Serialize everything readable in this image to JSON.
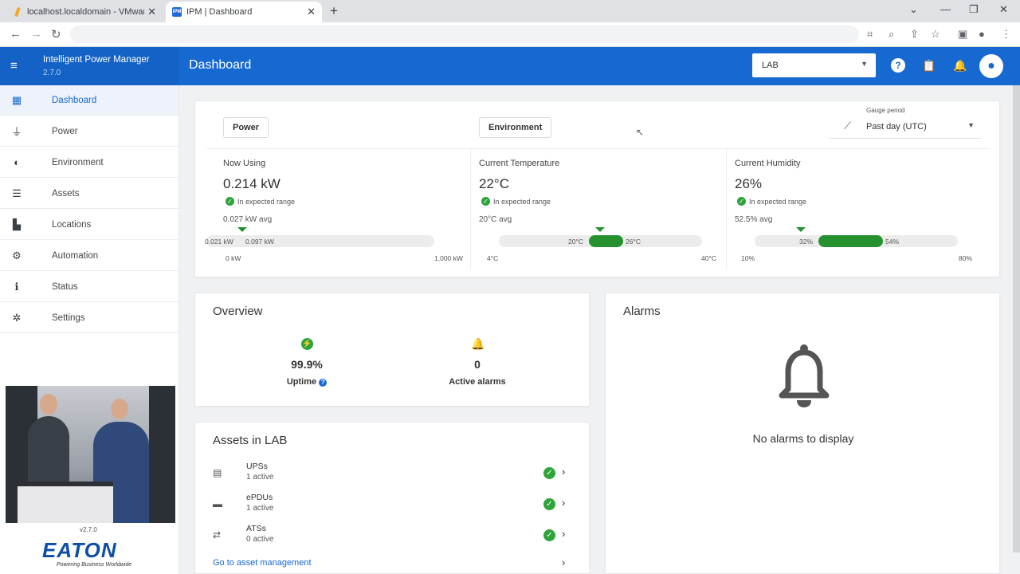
{
  "browser": {
    "tabs": [
      {
        "title": "localhost.localdomain - VMware"
      },
      {
        "title": "IPM | Dashboard"
      }
    ]
  },
  "header": {
    "app_name": "Intelligent Power Manager",
    "app_version": "2.7.0",
    "page_title": "Dashboard",
    "site_selected": "LAB",
    "brand_color": "#1769d2"
  },
  "sidebar": {
    "items": [
      {
        "label": "Dashboard",
        "icon": "dashboard-icon"
      },
      {
        "label": "Power",
        "icon": "plug-icon"
      },
      {
        "label": "Environment",
        "icon": "environment-icon"
      },
      {
        "label": "Assets",
        "icon": "assets-icon"
      },
      {
        "label": "Locations",
        "icon": "locations-icon"
      },
      {
        "label": "Automation",
        "icon": "automation-icon"
      },
      {
        "label": "Status",
        "icon": "info-icon"
      },
      {
        "label": "Settings",
        "icon": "gear-icon"
      }
    ],
    "footer_version": "v2.7.0",
    "logo_text": "EATON",
    "tagline": "Powering Business Worldwide"
  },
  "gauges": {
    "tabs": [
      "Power",
      "Environment"
    ],
    "period_label": "Gauge period",
    "period_value": "Past day (UTC)",
    "metrics": [
      {
        "title": "Now Using",
        "value": "0.214 kW",
        "status": "In expected range",
        "avg": "0.027 kW  avg",
        "range_low": "0.021 kW",
        "range_high": "0.097 kW",
        "min": "0 kW",
        "max": "1,000 kW"
      },
      {
        "title": "Current Temperature",
        "value": "22°C",
        "status": "In expected range",
        "avg": "20°C  avg",
        "range_low": "20°C",
        "range_high": "26°C",
        "min": "4°C",
        "max": "40°C"
      },
      {
        "title": "Current Humidity",
        "value": "26%",
        "status": "In expected range",
        "avg": "52.5%  avg",
        "range_low": "32%",
        "range_high": "54%",
        "min": "10%",
        "max": "80%"
      }
    ]
  },
  "overview": {
    "title": "Overview",
    "uptime_value": "99.9%",
    "uptime_label": "Uptime",
    "alarms_value": "0",
    "alarms_label": "Active alarms"
  },
  "assets": {
    "title": "Assets in LAB",
    "items": [
      {
        "name": "UPSs",
        "status": "1 active"
      },
      {
        "name": "ePDUs",
        "status": "1 active"
      },
      {
        "name": "ATSs",
        "status": "0 active"
      }
    ],
    "link": "Go to asset management"
  },
  "alarms": {
    "title": "Alarms",
    "empty_text": "No alarms to display"
  }
}
